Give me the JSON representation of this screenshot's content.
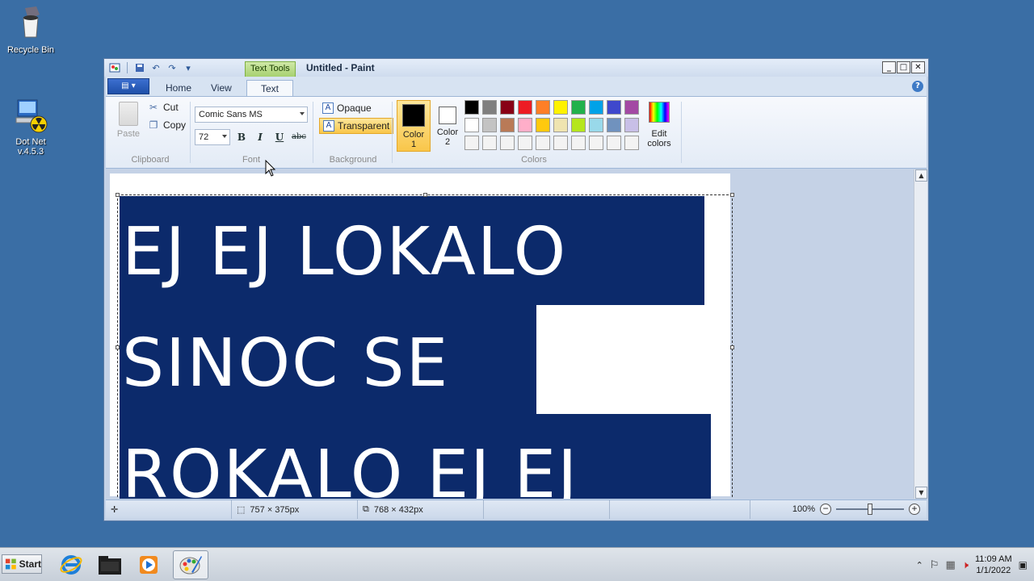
{
  "desktop": {
    "icons": [
      {
        "label": "Recycle Bin",
        "icon": "recycle-bin-icon"
      },
      {
        "label": "Dot Net\nv.4.5.3",
        "icon": "dotnet-installer-icon"
      }
    ]
  },
  "window": {
    "title": "Untitled - Paint",
    "contextual_tab": "Text Tools",
    "controls": {
      "minimize": "_",
      "maximize": "□",
      "close": "✕"
    },
    "help": "?"
  },
  "ribbon": {
    "tabs": [
      {
        "label": "Home",
        "active": false
      },
      {
        "label": "View",
        "active": false
      },
      {
        "label": "Text",
        "active": true
      }
    ],
    "clipboard": {
      "paste": "Paste",
      "cut": "Cut",
      "copy": "Copy",
      "group": "Clipboard"
    },
    "font": {
      "family": "Comic Sans MS",
      "size": "72",
      "bold": "B",
      "italic": "I",
      "underline": "U",
      "strike": "abc",
      "group": "Font"
    },
    "background": {
      "opaque": "Opaque",
      "transparent": "Transparent",
      "selected": "transparent",
      "group": "Background"
    },
    "colors": {
      "color1_label": "Color 1",
      "color2_label": "Color 2",
      "color1": "#000000",
      "color2": "#ffffff",
      "edit": "Edit colors",
      "group": "Colors",
      "palette": [
        "#000000",
        "#7f7f7f",
        "#880015",
        "#ed1c24",
        "#ff7f27",
        "#fff200",
        "#22b14c",
        "#00a2e8",
        "#3f48cc",
        "#a349a4",
        "#ffffff",
        "#c3c3c3",
        "#b97a57",
        "#ffaec9",
        "#ffc90e",
        "#efe4b0",
        "#b5e61d",
        "#99d9ea",
        "#7092be",
        "#c8bfe7",
        "#f3f3f3",
        "#f3f3f3",
        "#f3f3f3",
        "#f3f3f3",
        "#f3f3f3",
        "#f3f3f3",
        "#f3f3f3",
        "#f3f3f3",
        "#f3f3f3",
        "#f3f3f3"
      ]
    }
  },
  "canvas": {
    "text_lines": [
      "EJ EJ LOKALO",
      "SINOC SE",
      "ROKALO EJ EJ"
    ],
    "text_bg": "#0c2a6b",
    "text_color": "#ffffff"
  },
  "statusbar": {
    "selection_size": "757 × 375px",
    "canvas_size": "768 × 432px",
    "zoom": "100%",
    "zoom_level": 0.5
  },
  "taskbar": {
    "start": "Start",
    "apps": [
      "internet-explorer-icon",
      "file-explorer-icon",
      "media-player-icon",
      "paint-icon"
    ],
    "time": "11:09 AM",
    "date": "1/1/2022"
  }
}
